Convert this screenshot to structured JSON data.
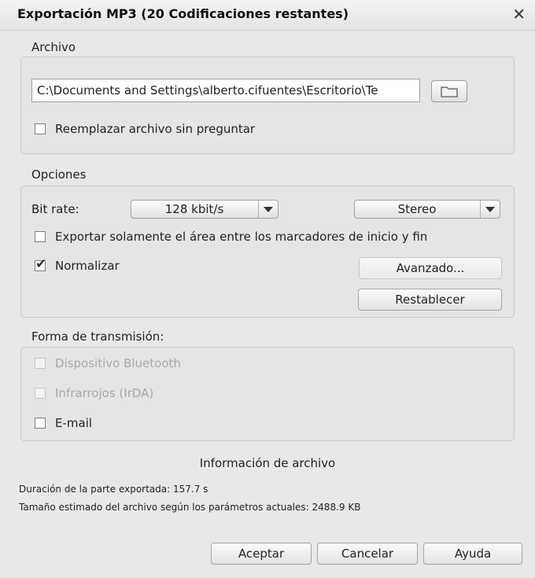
{
  "window": {
    "title": "Exportación MP3 (20 Codificaciones restantes)",
    "close_glyph": "✕"
  },
  "archivo": {
    "label": "Archivo",
    "path": "C:\\Documents and Settings\\alberto.cifuentes\\Escritorio\\Te",
    "replace_label": "Reemplazar archivo sin preguntar",
    "replace_checked": false,
    "folder_icon": "folder-icon"
  },
  "opciones": {
    "label": "Opciones",
    "bitrate_label": "Bit rate:",
    "bitrate_value": "128 kbit/s",
    "channel_value": "Stereo",
    "export_area_label": "Exportar solamente el área entre los marcadores de inicio y fin",
    "export_area_checked": false,
    "normalize_label": "Normalizar",
    "normalize_checked": true,
    "advanced_button": "Avanzado...",
    "reset_button": "Restablecer"
  },
  "transmision": {
    "label": "Forma de transmisión:",
    "bluetooth_label": "Dispositivo Bluetooth",
    "irda_label": "Infrarrojos (IrDA)",
    "email_label": "E-mail"
  },
  "info": {
    "title": "Información de archivo",
    "duration_line": "Duración de la parte exportada:  157.7 s",
    "size_line": "Tamaño estimado del archivo según los parámetros actuales:  2488.9 KB"
  },
  "buttons": {
    "ok": "Aceptar",
    "cancel": "Cancelar",
    "help": "Ayuda"
  },
  "colors": {
    "background": "#e8e8e8",
    "frame": "#e5e5e5",
    "disabled_text": "#a8a8a8"
  }
}
